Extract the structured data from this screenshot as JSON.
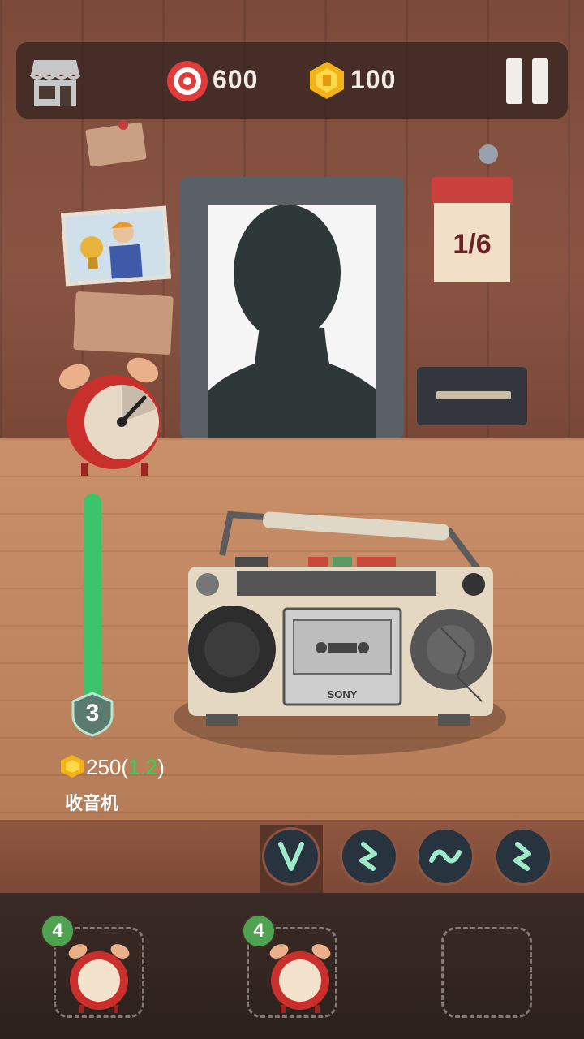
{
  "top_bar": {
    "target_score": "600",
    "coin_count": "100"
  },
  "calendar": {
    "day": "1/6"
  },
  "radio": {
    "brand": "SONY"
  },
  "item": {
    "level": "3",
    "income_value": "250(",
    "income_multiplier": "1.2",
    "income_close": ")",
    "name": "收音机",
    "progress_fraction": 1.0
  },
  "gestures": [
    {
      "icon": "v-gesture-icon"
    },
    {
      "icon": "zigzag-gesture-icon"
    },
    {
      "icon": "wave-gesture-icon"
    },
    {
      "icon": "zigzag-gesture-icon"
    }
  ],
  "inventory": [
    {
      "count": "4",
      "icon": "alarm-clock-icon"
    },
    {
      "count": "4",
      "icon": "alarm-clock-icon"
    },
    {
      "count": "",
      "icon": ""
    }
  ],
  "colors": {
    "accent_green": "#3cc46a",
    "clock_red": "#c9302c",
    "button_dark": "#27333f"
  }
}
